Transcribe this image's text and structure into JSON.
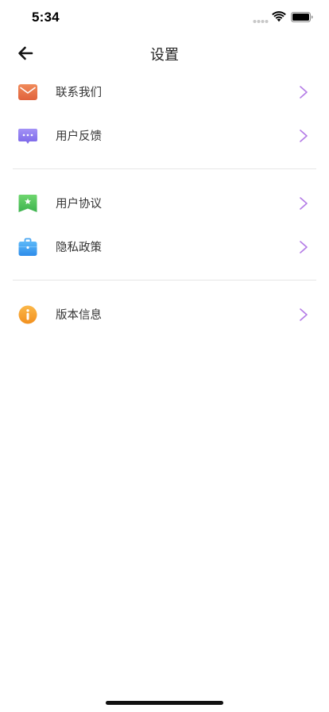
{
  "status_bar": {
    "time": "5:34"
  },
  "nav": {
    "title": "设置"
  },
  "sections": [
    {
      "items": [
        {
          "label": "联系我们",
          "icon": "mail-icon",
          "color": "#E8734A"
        },
        {
          "label": "用户反馈",
          "icon": "feedback-icon",
          "color": "#8C7BF0"
        }
      ]
    },
    {
      "items": [
        {
          "label": "用户协议",
          "icon": "agreement-icon",
          "color": "#4CC35A"
        },
        {
          "label": "隐私政策",
          "icon": "privacy-icon",
          "color": "#3A9DF0"
        }
      ]
    },
    {
      "items": [
        {
          "label": "版本信息",
          "icon": "info-icon",
          "color": "#F5A030"
        }
      ]
    }
  ],
  "accent_color": "#B47CE6"
}
